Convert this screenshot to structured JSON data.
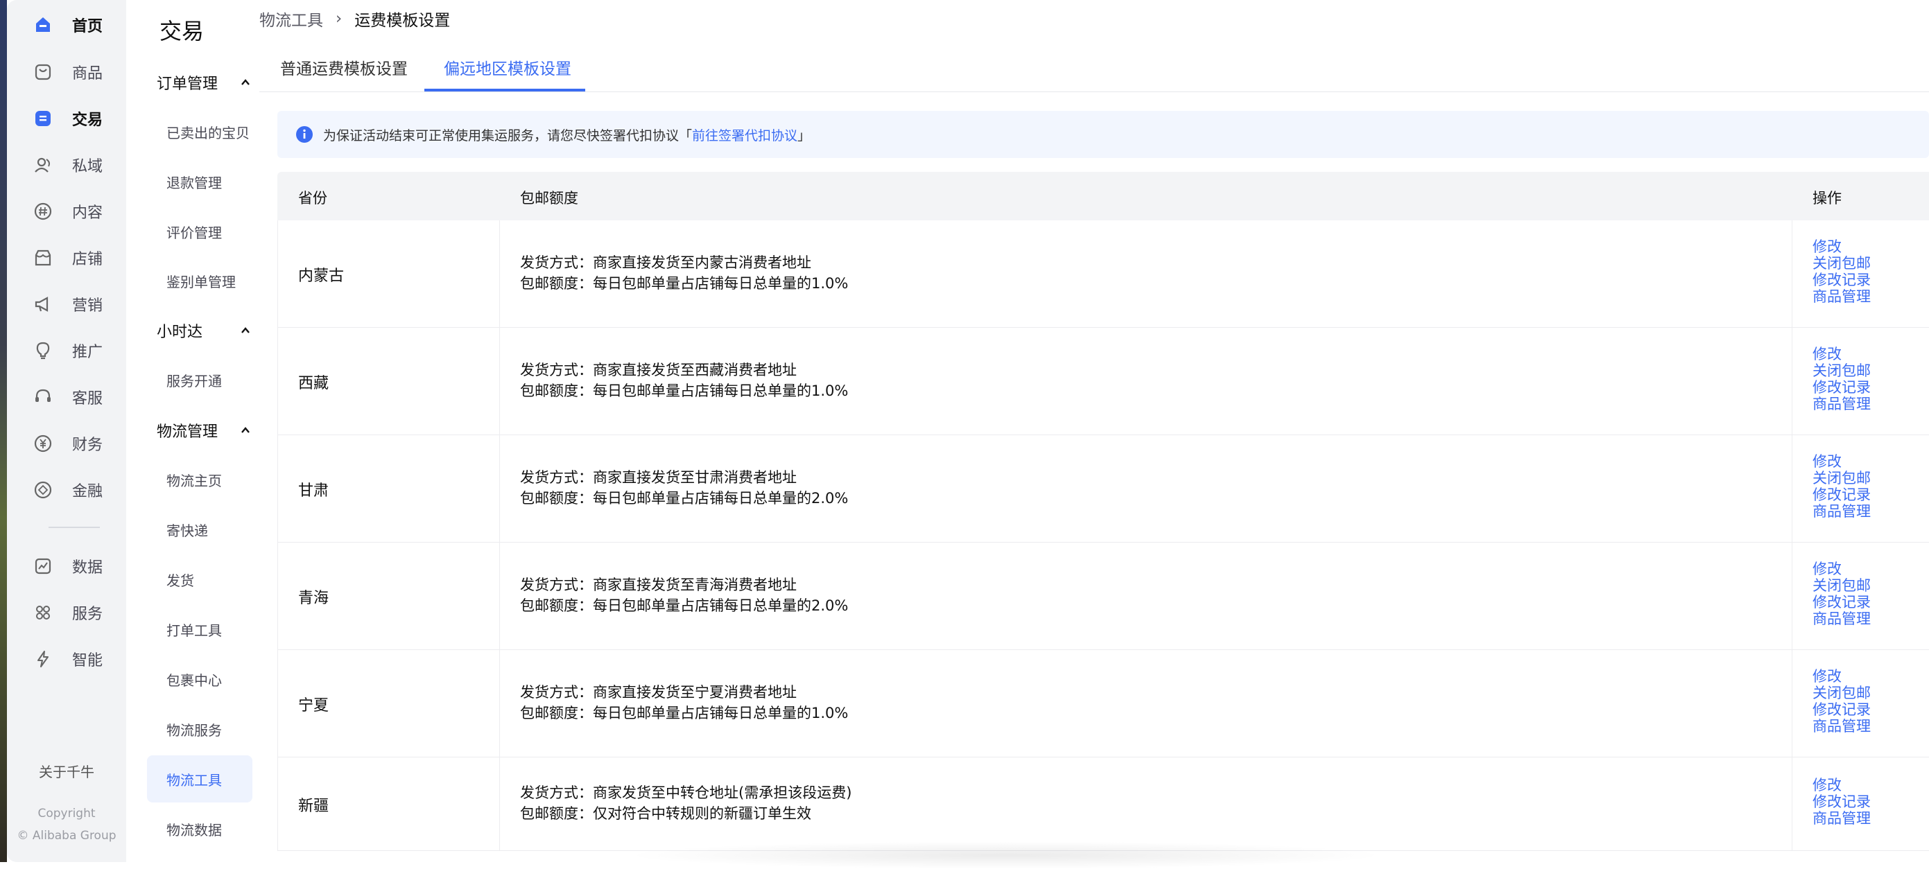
{
  "rail": {
    "items": [
      {
        "label": "首页",
        "icon": "home-icon",
        "active": false,
        "bold": true
      },
      {
        "label": "商品",
        "icon": "product-icon"
      },
      {
        "label": "交易",
        "icon": "trade-icon",
        "active": true
      },
      {
        "label": "私域",
        "icon": "people-icon"
      },
      {
        "label": "内容",
        "icon": "hash-icon"
      },
      {
        "label": "店铺",
        "icon": "shop-icon"
      },
      {
        "label": "营销",
        "icon": "megaphone-icon"
      },
      {
        "label": "推广",
        "icon": "bulb-icon"
      },
      {
        "label": "客服",
        "icon": "headset-icon"
      },
      {
        "label": "财务",
        "icon": "yuan-icon"
      },
      {
        "label": "金融",
        "icon": "finance-icon"
      },
      {
        "label": "数据",
        "icon": "chart-icon"
      },
      {
        "label": "服务",
        "icon": "grid-icon"
      },
      {
        "label": "智能",
        "icon": "bolt-icon"
      }
    ],
    "about": "关于千牛",
    "copyright_1": "Copyright",
    "copyright_2": "© Alibaba Group"
  },
  "menu": {
    "title": "交易",
    "groups": [
      {
        "label": "订单管理",
        "items": [
          "已卖出的宝贝",
          "退款管理",
          "评价管理",
          "鉴别单管理"
        ]
      },
      {
        "label": "小时达",
        "items": [
          "服务开通"
        ]
      },
      {
        "label": "物流管理",
        "items": [
          "物流主页",
          "寄快递",
          "发货",
          "打单工具",
          "包裹中心",
          "物流服务",
          "物流工具",
          "物流数据"
        ]
      }
    ],
    "active_item": "物流工具"
  },
  "breadcrumb": {
    "parent": "物流工具",
    "separator": "›",
    "current": "运费模板设置"
  },
  "tabs": [
    {
      "label": "普通运费模板设置",
      "active": false
    },
    {
      "label": "偏远地区模板设置",
      "active": true
    }
  ],
  "notice": {
    "text": "为保证活动结束可正常使用集运服务，请您尽快签署代扣协议「",
    "link": "前往签署代扣协议",
    "text_end": "」"
  },
  "table": {
    "headers": {
      "province": "省份",
      "quota": "包邮额度",
      "ops": "操作"
    },
    "rows": [
      {
        "province": "内蒙古",
        "line1": "发货方式：商家直接发货至内蒙古消费者地址",
        "line2": "包邮额度：每日包邮单量占店铺每日总单量的1.0%",
        "ops": [
          "修改",
          "关闭包邮",
          "修改记录",
          "商品管理"
        ]
      },
      {
        "province": "西藏",
        "line1": "发货方式：商家直接发货至西藏消费者地址",
        "line2": "包邮额度：每日包邮单量占店铺每日总单量的1.0%",
        "ops": [
          "修改",
          "关闭包邮",
          "修改记录",
          "商品管理"
        ]
      },
      {
        "province": "甘肃",
        "line1": "发货方式：商家直接发货至甘肃消费者地址",
        "line2": "包邮额度：每日包邮单量占店铺每日总单量的2.0%",
        "ops": [
          "修改",
          "关闭包邮",
          "修改记录",
          "商品管理"
        ]
      },
      {
        "province": "青海",
        "line1": "发货方式：商家直接发货至青海消费者地址",
        "line2": "包邮额度：每日包邮单量占店铺每日总单量的2.0%",
        "ops": [
          "修改",
          "关闭包邮",
          "修改记录",
          "商品管理"
        ]
      },
      {
        "province": "宁夏",
        "line1": "发货方式：商家直接发货至宁夏消费者地址",
        "line2": "包邮额度：每日包邮单量占店铺每日总单量的1.0%",
        "ops": [
          "修改",
          "关闭包邮",
          "修改记录",
          "商品管理"
        ]
      },
      {
        "province": "新疆",
        "line1": "发货方式：商家发货至中转仓地址(需承担该段运费)",
        "line2": "包邮额度：仅对符合中转规则的新疆订单生效",
        "ops": [
          "修改",
          "修改记录",
          "商品管理"
        ]
      }
    ]
  },
  "colors": {
    "accent": "#3b6cf2",
    "rail_bg": "#f2f3f5",
    "header_bg": "#f3f4f6",
    "notice_bg": "#f2f6fe"
  }
}
